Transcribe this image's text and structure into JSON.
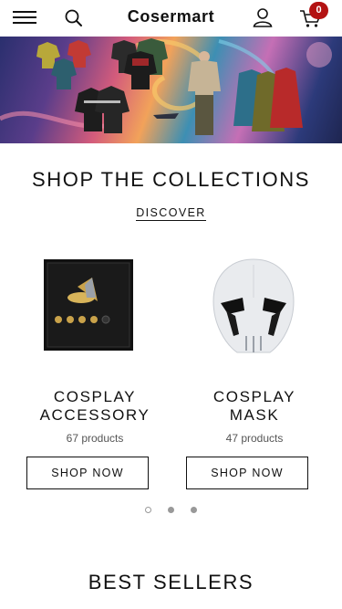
{
  "header": {
    "logo": "Cosermart",
    "cart_count": "0",
    "icons": [
      "menu-icon",
      "search-icon",
      "account-icon",
      "cart-icon"
    ]
  },
  "collections": {
    "title": "SHOP THE COLLECTIONS",
    "discover_label": "DISCOVER",
    "items": [
      {
        "title_line1": "COSPLAY",
        "title_line2": "ACCESSORY",
        "count": "67 products",
        "button": "SHOP NOW"
      },
      {
        "title_line1": "COSPLAY",
        "title_line2": "MASK",
        "count": "47 products",
        "button": "SHOP NOW"
      }
    ],
    "carousel": {
      "total": 3,
      "active": 1
    }
  },
  "best_sellers": {
    "title": "BEST SELLERS"
  },
  "colors": {
    "badge": "#b31212",
    "text": "#111111",
    "muted": "#555555"
  }
}
